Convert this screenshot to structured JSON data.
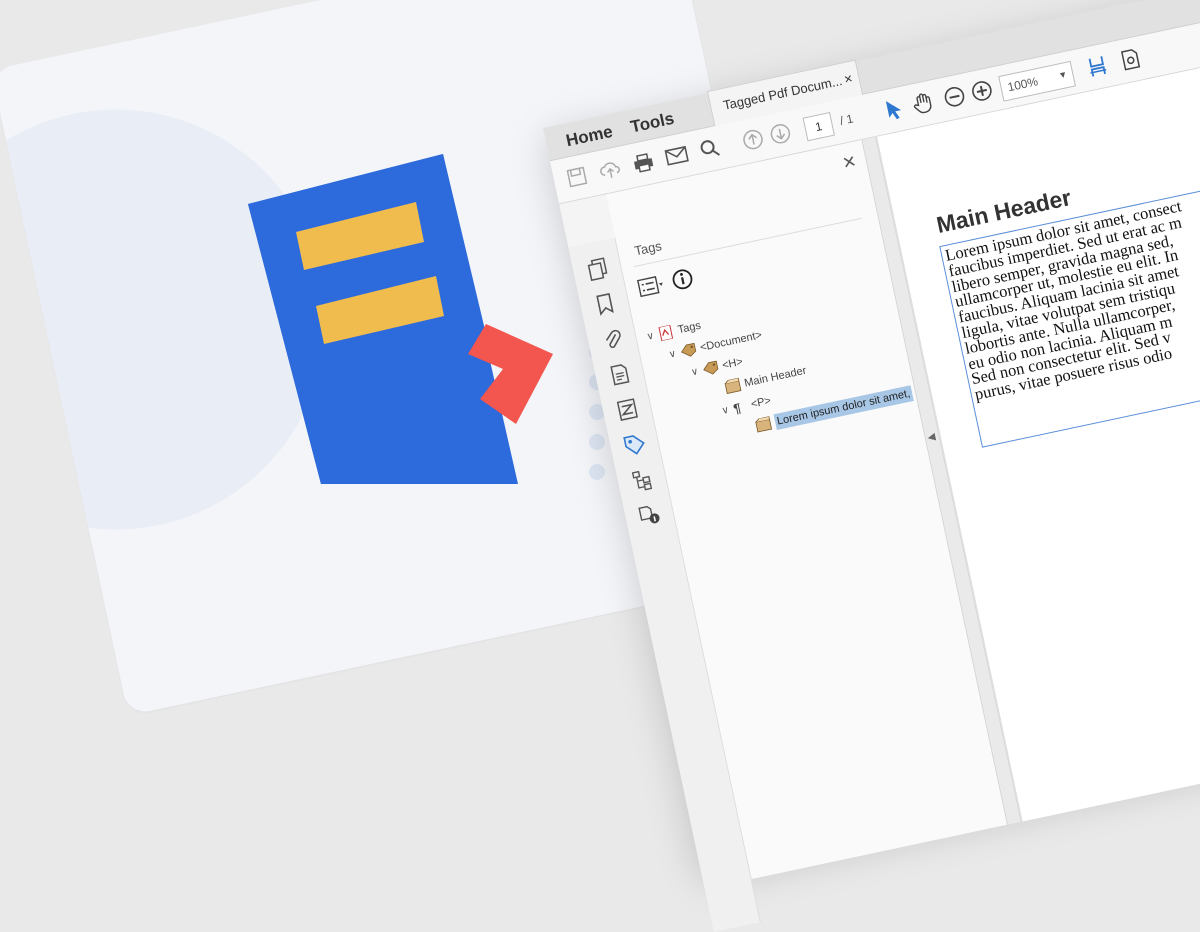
{
  "colors": {
    "logo_blue": "#2d6adb",
    "logo_yellow": "#f0bc4d",
    "logo_red": "#f2564e",
    "accent": "#2f78d0"
  },
  "menu": {
    "home": "Home",
    "tools": "Tools",
    "doc_tab": "Tagged Pdf Docum...",
    "doc_tab_close": "×"
  },
  "toolbar": {
    "page_current": "1",
    "page_total": "/ 1",
    "zoom": "100%"
  },
  "tags_panel": {
    "title": "Tags",
    "close": "×",
    "tree": [
      {
        "label": "Tags",
        "icon": "pdf-tag-root-icon"
      },
      {
        "label": "<Document>",
        "icon": "tag-icon"
      },
      {
        "label": "<H>",
        "icon": "tag-icon"
      },
      {
        "label": "Main Header",
        "icon": "content-box-icon"
      },
      {
        "label": "<P>",
        "icon": "paragraph-icon"
      },
      {
        "label": "Lorem ipsum dolor sit amet,",
        "icon": "content-box-icon"
      }
    ]
  },
  "document": {
    "heading": "Main Header",
    "lines": [
      "Lorem ipsum dolor sit amet, consect",
      "faucibus imperdiet. Sed ut erat ac m",
      "libero semper, gravida magna sed,",
      "ullamcorper ut, molestie eu elit. In",
      "faucibus. Aliquam lacinia sit amet",
      "ligula, vitae volutpat sem tristiqu",
      "lobortis ante. Nulla ullamcorper,",
      "eu odio non lacinia. Aliquam m",
      "Sed non consectetur elit. Sed v",
      "purus, vitae posuere risus odio"
    ]
  }
}
